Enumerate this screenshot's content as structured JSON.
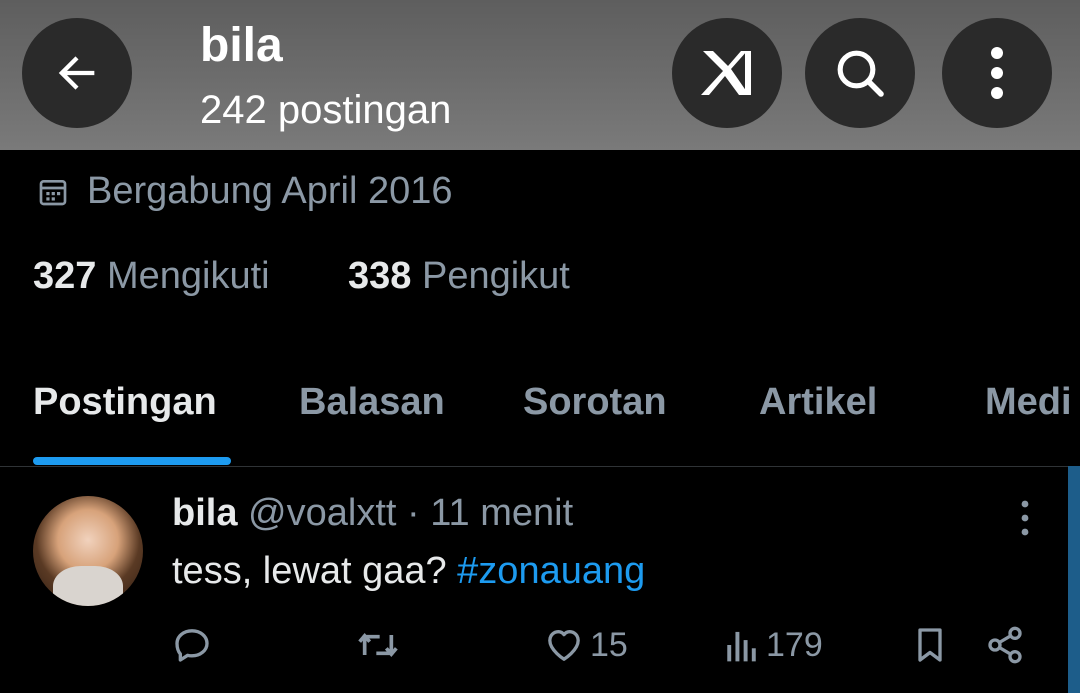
{
  "header": {
    "name": "bila",
    "post_count": "242 postingan",
    "icons": [
      "back-arrow-icon",
      "grok-icon",
      "search-icon",
      "more-vertical-icon"
    ]
  },
  "profile": {
    "joined": "Bergabung April 2016",
    "following_count": "327",
    "following_label": "Mengikuti",
    "followers_count": "338",
    "followers_label": "Pengikut"
  },
  "tabs": [
    {
      "label": "Postingan",
      "active": true
    },
    {
      "label": "Balasan",
      "active": false
    },
    {
      "label": "Sorotan",
      "active": false
    },
    {
      "label": "Artikel",
      "active": false
    },
    {
      "label": "Medi",
      "active": false
    }
  ],
  "post": {
    "name": "bila",
    "handle": "@voalxtt",
    "separator": " · ",
    "time": "11 menit",
    "text": "tess, lewat gaa? ",
    "hashtag": "#zonauang",
    "likes": "15",
    "views": "179"
  },
  "colors": {
    "accent": "#1d9bf0",
    "muted_text": "#8b98a5",
    "primary_text": "#e7e9ea",
    "background": "#000000"
  }
}
